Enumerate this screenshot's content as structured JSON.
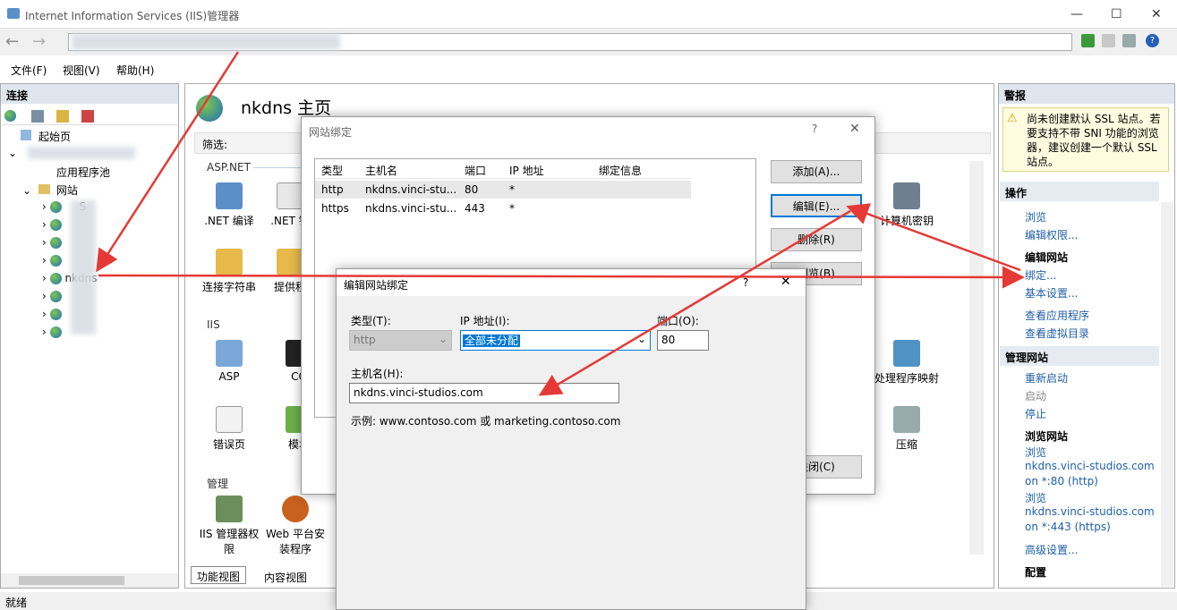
{
  "window": {
    "title": "Internet Information Services (IIS)管理器"
  },
  "menu": [
    "文件(F)",
    "视图(V)",
    "帮助(H)"
  ],
  "left": {
    "header": "连接",
    "start": "起始页",
    "apppools": "应用程序池",
    "sites": "网站",
    "site_partial": "S",
    "selected": "nkdns"
  },
  "center": {
    "title": "nkdns 主页",
    "filter": "筛选:",
    "sec_aspnet": "ASP.NET",
    "net_compile": ".NET 编译",
    "net_trust": ".NET 错",
    "conn_str": "连接字符串",
    "provider": "提供程",
    "sec_iis": "IIS",
    "asp": "ASP",
    "cgi": "CG",
    "error_pages": "错误页",
    "modules": "模块",
    "sec_manage": "管理",
    "iis_perm": "IIS 管理器权限",
    "web_install": "Web 平台安装程序",
    "machine_key": "计算机密钥",
    "handler": "处理程序映射",
    "compress": "压缩",
    "tab_feature": "功能视图",
    "tab_content": "内容视图"
  },
  "status": "就绪",
  "bindings": {
    "title": "网站绑定",
    "help": "?",
    "cols": [
      "类型",
      "主机名",
      "端口",
      "IP 地址",
      "绑定信息"
    ],
    "rows": [
      [
        "http",
        "nkdns.vinci-stu...",
        "80",
        "*",
        ""
      ],
      [
        "https",
        "nkdns.vinci-stu...",
        "443",
        "*",
        ""
      ]
    ],
    "add": "添加(A)...",
    "edit": "编辑(E)...",
    "remove": "删除(R)",
    "browse": "浏览(B)",
    "close": "关闭(C)"
  },
  "edit": {
    "title": "编辑网站绑定",
    "help": "?",
    "type_label": "类型(T):",
    "type_value": "http",
    "ip_label": "IP 地址(I):",
    "ip_value": "全部未分配",
    "port_label": "端口(O):",
    "port_value": "80",
    "host_label": "主机名(H):",
    "host_value": "nkdns.vinci-studios.com",
    "example": "示例: www.contoso.com 或 marketing.contoso.com"
  },
  "right": {
    "alerts": "警报",
    "alert_text": [
      "尚未创建默认 SSL 站点。若",
      "要支持不带 SNI 功能的浏览",
      "器，建议创建一个默认 SSL",
      "站点。"
    ],
    "actions": "操作",
    "browse": "浏览",
    "edit_perm": "编辑权限...",
    "edit_site": "编辑网站",
    "bind": "绑定...",
    "basic": "基本设置...",
    "view_apps": "查看应用程序",
    "view_vdirs": "查看虚拟目录",
    "manage": "管理网站",
    "restart": "重新启动",
    "start": "启动",
    "stop": "停止",
    "browse_site": "浏览网站",
    "b1a": "浏览",
    "b1b": "nkdns.vinci-studios.com",
    "b1c": "on *:80 (http)",
    "b2a": "浏览",
    "b2b": "nkdns.vinci-studios.com",
    "b2c": "on *:443 (https)",
    "advanced": "高级设置...",
    "config": "配置"
  }
}
